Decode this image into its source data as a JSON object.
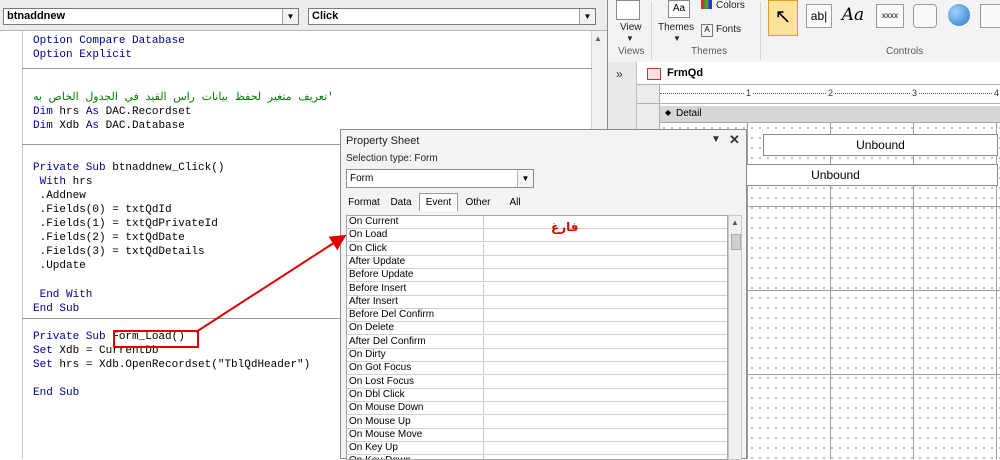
{
  "vba": {
    "object_combo": "btnaddnew",
    "proc_combo": "Click",
    "lines": {
      "l1a": "Option",
      "l1b": " Compare Database",
      "l2a": "Option",
      "l2b": " Explicit",
      "comment": "'تعريف متغير لحفظ بيانات راس القيد في الجدول الخاص به",
      "l4a": "Dim",
      "l4b": " hrs ",
      "l4c": "As",
      "l4d": " DAC.Recordset",
      "l5a": "Dim",
      "l5b": " Xdb ",
      "l5c": "As",
      "l5d": " DAC.Database",
      "l6a": "Private Sub",
      "l6b": " btnaddnew_Click()",
      "l7a": " With",
      "l7b": " hrs",
      "l8": " .Addnew",
      "l9": " .Fields(0) = txtQdId",
      "l10": " .Fields(1) = txtQdPrivateId",
      "l11": " .Fields(2) = txtQdDate",
      "l12": " .Fields(3) = txtQdDetails",
      "l13": " .Update",
      "l14": " End With",
      "l15": "End Sub",
      "l16a": "Private Sub",
      "l16b": " Form_Load()",
      "l17a": "Set",
      "l17b": " Xdb = CurrentDb",
      "l18a": "Set",
      "l18b": " hrs = Xdb.OpenRecordset(\"TblQdHeader\")",
      "l19": "End Sub"
    }
  },
  "ribbon": {
    "view_label": "View",
    "views_group": "Views",
    "themes_label": "Themes",
    "colors_label": "Colors",
    "fonts_label": "Fonts",
    "themes_group": "Themes",
    "controls_group": "Controls",
    "textbox_icon": "ab|",
    "label_icon": "Aa",
    "button_icon": "xxxx"
  },
  "form": {
    "tab_title": "FrmQd",
    "detail_label": "Detail",
    "ruler_marks": [
      "1",
      "2",
      "3",
      "4"
    ],
    "unbound_1": "Unbound",
    "unbound_2": "Unbound"
  },
  "property_sheet": {
    "title": "Property Sheet",
    "selection_type": "Selection type:  Form",
    "selected": "Form",
    "tabs": [
      "Format",
      "Data",
      "Event",
      "Other",
      "All"
    ],
    "active_tab": "Event",
    "properties": [
      "On Current",
      "On Load",
      "On Click",
      "After Update",
      "Before Update",
      "Before Insert",
      "After Insert",
      "Before Del Confirm",
      "On Delete",
      "After Del Confirm",
      "On Dirty",
      "On Got Focus",
      "On Lost Focus",
      "On Dbl Click",
      "On Mouse Down",
      "On Mouse Up",
      "On Mouse Move",
      "On Key Up",
      "On Key Down"
    ]
  },
  "annotation": "فارغ",
  "colors": {
    "annotation_red": "#e00000",
    "vba_keyword": "#00008b",
    "vba_comment": "#008000"
  }
}
